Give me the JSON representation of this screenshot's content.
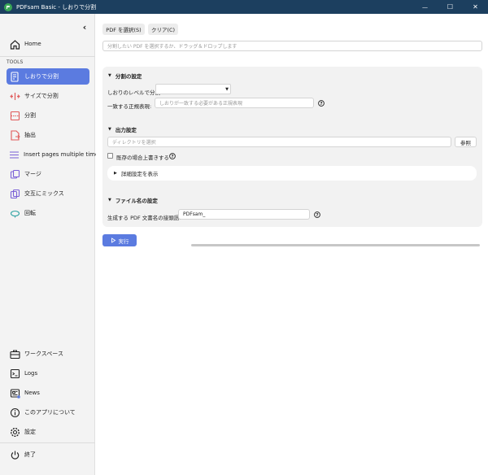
{
  "window": {
    "title": "PDFsam Basic - しおりで分割",
    "minimize_glyph": "—",
    "maximize_glyph": "☐",
    "close_glyph": "✕"
  },
  "sidebar": {
    "collapse_glyph": "‹",
    "home_label": "Home",
    "tools_header": "TOOLS",
    "tools": [
      {
        "label": "しおりで分割",
        "icon": "bookmark-split-icon"
      },
      {
        "label": "サイズで分割",
        "icon": "size-split-icon"
      },
      {
        "label": "分割",
        "icon": "split-icon"
      },
      {
        "label": "抽出",
        "icon": "extract-icon"
      },
      {
        "label": "Insert pages multiple times",
        "icon": "insert-pages-icon"
      },
      {
        "label": "マージ",
        "icon": "merge-icon"
      },
      {
        "label": "交互にミックス",
        "icon": "alternate-mix-icon"
      },
      {
        "label": "回転",
        "icon": "rotate-icon"
      }
    ],
    "bottom": [
      {
        "label": "ワークスペース",
        "icon": "briefcase-icon"
      },
      {
        "label": "Logs",
        "icon": "logs-icon"
      },
      {
        "label": "News",
        "icon": "news-icon"
      },
      {
        "label": "このアプリについて",
        "icon": "info-icon"
      },
      {
        "label": "設定",
        "icon": "gear-icon"
      }
    ],
    "exit_label": "終了",
    "accent_color": "#5b7be0"
  },
  "main": {
    "select_pdf_label": "PDF を選択(S)",
    "clear_label": "クリア(C)",
    "drop_placeholder": "分割したい PDF を選択するか、ドラッグ＆ドロップします",
    "split_settings": {
      "header": "分割の設定",
      "level_label": "しおりのレベルで分割:",
      "level_value": "",
      "regex_label": "一致する正規表現:",
      "regex_placeholder": "しおりが一致する必要がある正規表現"
    },
    "output_settings": {
      "header": "出力設定",
      "dir_placeholder": "ディレクトリを選択",
      "browse_label": "参照",
      "overwrite_label": "既存の場合上書きする",
      "overwrite_checked": false,
      "advanced_label": "詳細設定を表示"
    },
    "filename_settings": {
      "header": "ファイル名の設定",
      "prefix_label": "生成する PDF 文書名の接頭語:",
      "prefix_value": "PDFsam_"
    },
    "run_label": "実行",
    "progress": 0
  }
}
